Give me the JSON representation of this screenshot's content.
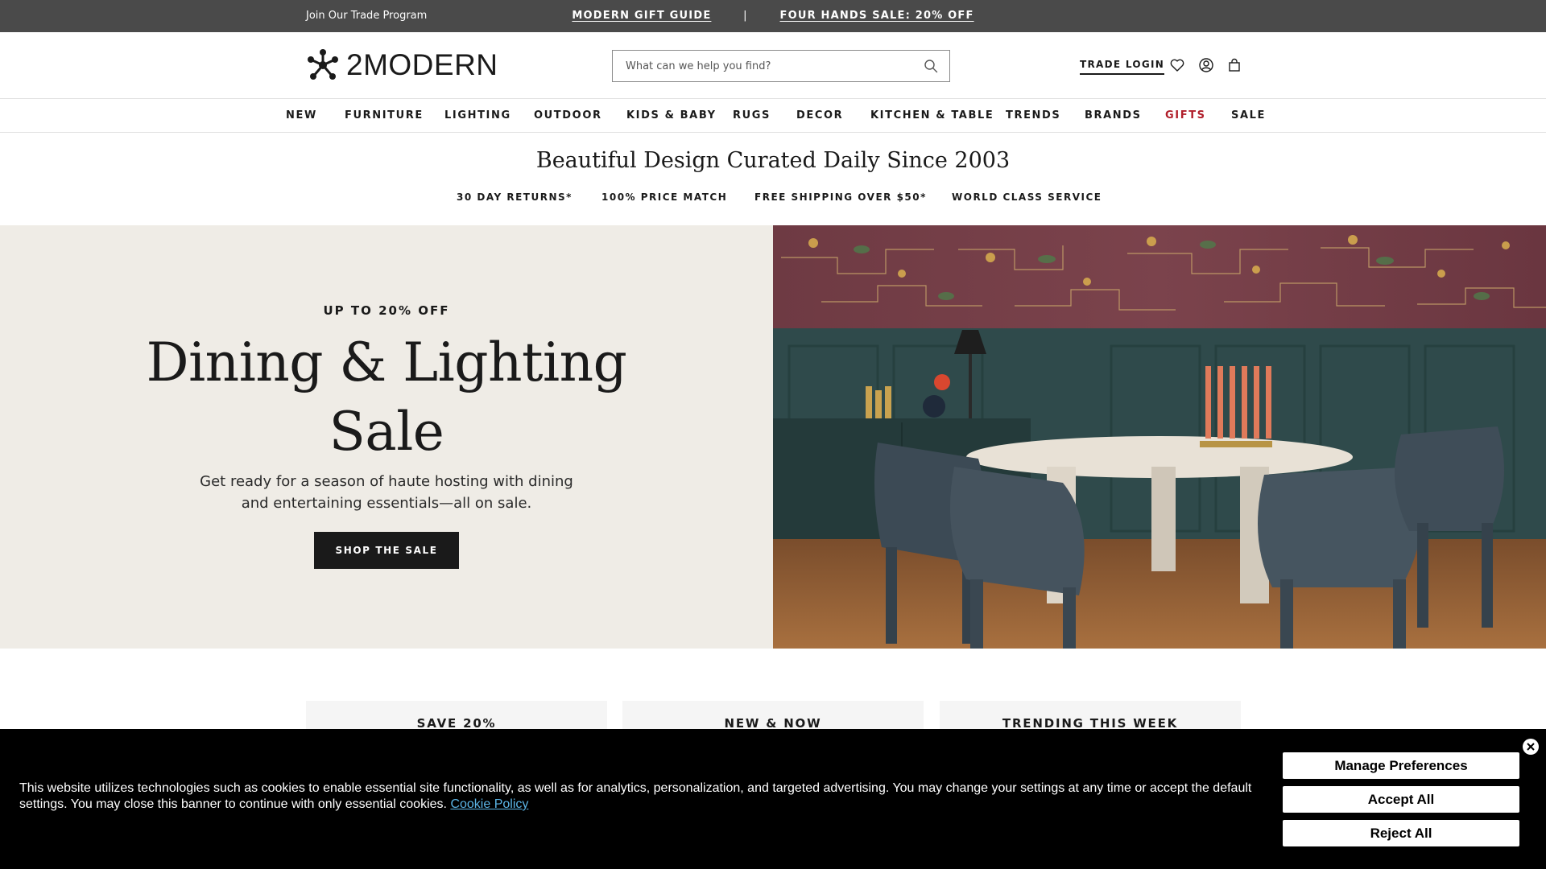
{
  "topbar": {
    "trade_program": "Join Our Trade Program",
    "promo_1": "MODERN GIFT GUIDE",
    "separator": "|",
    "promo_2": "FOUR HANDS SALE: 20% OFF"
  },
  "header": {
    "logo_text": "2MODERN",
    "search_placeholder": "What can we help you find?",
    "trade_login": "TRADE LOGIN",
    "icons": [
      "search-icon",
      "heart-icon",
      "account-icon",
      "bag-icon"
    ]
  },
  "nav": {
    "items": [
      "NEW",
      "FURNITURE",
      "LIGHTING",
      "OUTDOOR",
      "KIDS & BABY",
      "RUGS",
      "DECOR",
      "KITCHEN & TABLE",
      "TRENDS",
      "BRANDS",
      "GIFTS",
      "SALE"
    ],
    "highlight_color": "#b01e2a"
  },
  "tagline": "Beautiful Design Curated Daily Since 2003",
  "benefits": [
    "30 DAY RETURNS*",
    "100% PRICE MATCH",
    "FREE SHIPPING OVER $50*",
    "WORLD CLASS SERVICE"
  ],
  "hero": {
    "kicker": "UP TO 20% OFF",
    "headline_line1": "Dining & Lighting",
    "headline_line2": "Sale",
    "description": "Get ready for a season of haute hosting with dining and entertaining essentials—all on sale.",
    "cta": "SHOP THE SALE",
    "background": "#efece6"
  },
  "tiles": [
    "SAVE 20%",
    "NEW & NOW",
    "TRENDING THIS WEEK"
  ],
  "cookie": {
    "message": "This website utilizes technologies such as cookies to enable essential site functionality, as well as for analytics, personalization, and targeted advertising. You may change your settings at any time or accept the default settings. You may close this banner to continue with only essential cookies.",
    "policy_link": "Cookie Policy",
    "manage": "Manage Preferences",
    "accept": "Accept All",
    "reject": "Reject All"
  },
  "colors": {
    "topbar": "#4a4a4a",
    "cookie_bg": "#000000",
    "link": "#5bb4e5"
  }
}
